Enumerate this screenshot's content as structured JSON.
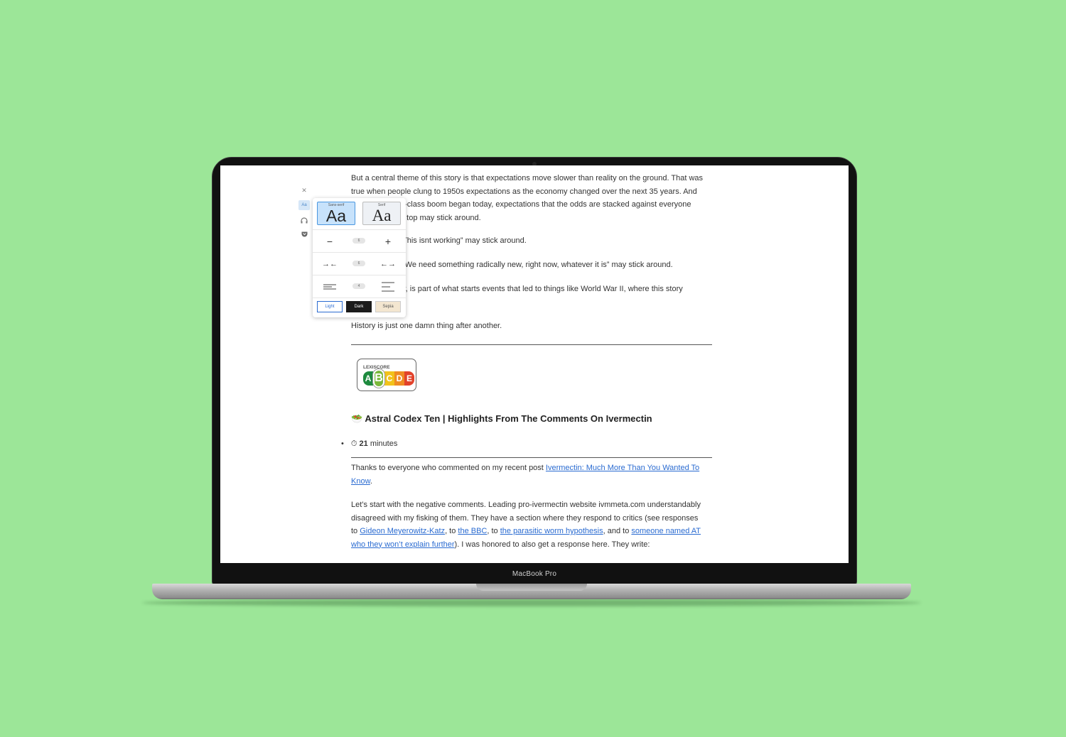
{
  "device": {
    "label": "MacBook Pro"
  },
  "reader_rail": {
    "close_glyph": "✕",
    "text_settings_label": "Aa",
    "listen_glyph": "🎧",
    "save_glyph": "⛉"
  },
  "settings": {
    "fonts": [
      {
        "label": "Sans-serif",
        "sample": "Aa",
        "selected": true
      },
      {
        "label": "Serif",
        "sample": "Aa",
        "selected": false
      }
    ],
    "font_size": {
      "decrease": "−",
      "value": "6",
      "increase": "+"
    },
    "line_width": {
      "narrow": "→←",
      "value": "6",
      "wide": "←→"
    },
    "line_spacing": {
      "value": "4"
    },
    "themes": [
      {
        "label": "Light",
        "bg": "#ffffff",
        "fg": "#2a6bd1"
      },
      {
        "label": "Dark",
        "bg": "#1b1b1b",
        "fg": "#ffffff"
      },
      {
        "label": "Sepia",
        "bg": "#f3e6d0",
        "fg": "#555555"
      }
    ]
  },
  "article": {
    "p1_line1": "But a central theme of this story is that expectations move slower than reality on the ground. That was",
    "p1_line2": "true when people clung to 1950s expectations as the economy changed over the next 35 years. And",
    "p1_line3": "e-class boom began today, expectations that the odds are stacked against everyone",
    "p1_line4": "e top may stick around.",
    "p2": "This isnt working” may stick around.",
    "p3": "“We need something radically new, right now, whatever it is” may stick around.",
    "p4_line1": "y, is part of what starts events that led to things like World War II, where this story",
    "p5": "History is just one damn thing after another.",
    "lexiscore": {
      "title": "LEXISCORE",
      "grades": [
        "A",
        "B",
        "C",
        "D",
        "E"
      ],
      "highlighted": "B",
      "colors": [
        "#1e8a3e",
        "#7ab83a",
        "#f2c21b",
        "#ef8b23",
        "#e2422b"
      ]
    },
    "next_title_emoji": "🥗",
    "next_title": "Astral Codex Ten | Highlights From The Comments On Ivermectin",
    "read_time_emoji": "⏱",
    "read_time_value": "21",
    "read_time_unit": " minutes",
    "c1_pre": "Thanks to everyone who commented on my recent post ",
    "c1_link_a": "Ivermectin: Much More Than You Wanted To",
    "c1_link_b": "Know",
    "c1_post": ".",
    "c2_line1": "Let’s start with the negative comments. Leading pro-ivermectin website ivmmeta.com understandably",
    "c2_line2": "disagreed with my fisking of them. They have a section where they respond to critics (see responses",
    "c2_l3_a": "to ",
    "c2_link1": "Gideon Meyerowitz-Katz",
    "c2_l3_b": ", to ",
    "c2_link2": "the BBC",
    "c2_l3_c": ", to ",
    "c2_link3": "the parasitic worm hypothesis",
    "c2_l3_d": ", and to ",
    "c2_link4": "someone named AT",
    "c2_link4b": "who they won’t explain further",
    "c2_l4_b": "). I was honored to also get a response here. They write:"
  }
}
